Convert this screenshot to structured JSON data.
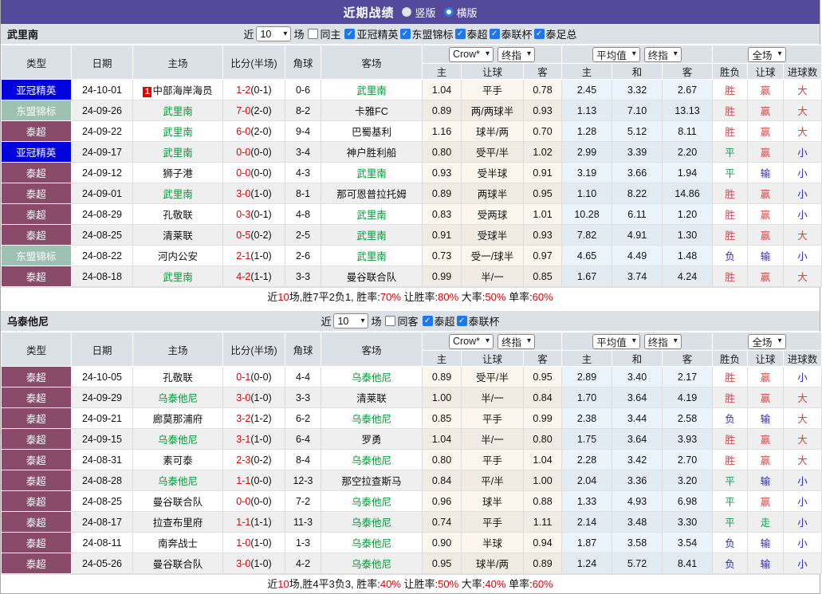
{
  "colors": {
    "bar": "#54499b",
    "headbg": "#dce1e8",
    "acl": "#0202dd",
    "asean": "#9dc1b2",
    "thai": "#8a4b6b",
    "green": "#009933",
    "red": "#e60000",
    "resred": "#d94545",
    "resblue": "#2a2ac8",
    "resgreen": "#13a04c",
    "cream1": "#fbf6ee",
    "cream2": "#f0ece4",
    "blue1": "#eaf4fa",
    "blue2": "#e1ebf1",
    "cbblue": "#1d78ee"
  },
  "titlebar": {
    "title": "近期战绩",
    "layout_options": [
      {
        "label": "竖版",
        "selected": false
      },
      {
        "label": "横版",
        "selected": true
      }
    ]
  },
  "sections": [
    {
      "team": "武里南",
      "controls": {
        "near": "近",
        "count": "10",
        "unit": "场",
        "venue_filter": {
          "label": "同主",
          "checked": false
        },
        "league_filters": [
          {
            "label": "亚冠精英",
            "checked": true
          },
          {
            "label": "东盟锦标",
            "checked": true
          },
          {
            "label": "泰超",
            "checked": true
          },
          {
            "label": "泰联杯",
            "checked": true
          },
          {
            "label": "泰足总",
            "checked": true
          }
        ]
      },
      "selects": {
        "bookmaker": "Crow*",
        "final1": "终指",
        "average": "平均值",
        "final2": "终指",
        "scope": "全场"
      },
      "cols": {
        "type": "类型",
        "date": "日期",
        "home": "主场",
        "score": "比分(半场)",
        "corner": "角球",
        "away": "客场",
        "h": "主",
        "handicap": "让球",
        "a": "客",
        "avg_h": "主",
        "avg_d": "和",
        "avg_a": "客",
        "result": "胜负",
        "hres": "让球",
        "goals": "进球数"
      },
      "rows": [
        {
          "lg": "亚冠精英",
          "lgc": "acl",
          "date": "24-10-01",
          "home": "中部海岸海员",
          "hred": true,
          "hteam": false,
          "score": "1-2",
          "half": "(0-1)",
          "cn": "0-6",
          "away": "武里南",
          "ateam": true,
          "o1": "1.04",
          "line": "平手",
          "o2": "0.78",
          "a1": "2.45",
          "a2": "3.32",
          "a3": "2.67",
          "r": [
            "胜",
            "r"
          ],
          "h": [
            "赢",
            "r"
          ],
          "g": [
            "大",
            "r"
          ]
        },
        {
          "lg": "东盟锦标",
          "lgc": "asean",
          "date": "24-09-26",
          "home": "武里南",
          "hred": false,
          "hteam": true,
          "score": "7-0",
          "half": "(2-0)",
          "cn": "8-2",
          "away": "卡雅FC",
          "ateam": false,
          "o1": "0.89",
          "line": "两/两球半",
          "o2": "0.93",
          "a1": "1.13",
          "a2": "7.10",
          "a3": "13.13",
          "r": [
            "胜",
            "r"
          ],
          "h": [
            "赢",
            "r"
          ],
          "g": [
            "大",
            "r"
          ]
        },
        {
          "lg": "泰超",
          "lgc": "thai",
          "date": "24-09-22",
          "home": "武里南",
          "hred": false,
          "hteam": true,
          "score": "6-0",
          "half": "(2-0)",
          "cn": "9-4",
          "away": "巴蜀基利",
          "ateam": false,
          "o1": "1.16",
          "line": "球半/两",
          "o2": "0.70",
          "a1": "1.28",
          "a2": "5.12",
          "a3": "8.11",
          "r": [
            "胜",
            "r"
          ],
          "h": [
            "赢",
            "r"
          ],
          "g": [
            "大",
            "r"
          ]
        },
        {
          "lg": "亚冠精英",
          "lgc": "acl",
          "date": "24-09-17",
          "home": "武里南",
          "hred": false,
          "hteam": true,
          "score": "0-0",
          "half": "(0-0)",
          "cn": "3-4",
          "away": "神户胜利船",
          "ateam": false,
          "o1": "0.80",
          "line": "受平/半",
          "o2": "1.02",
          "a1": "2.99",
          "a2": "3.39",
          "a3": "2.20",
          "r": [
            "平",
            "g"
          ],
          "h": [
            "赢",
            "r"
          ],
          "g": [
            "小",
            "b"
          ]
        },
        {
          "lg": "泰超",
          "lgc": "thai",
          "date": "24-09-12",
          "home": "狮子港",
          "hred": false,
          "hteam": false,
          "score": "0-0",
          "half": "(0-0)",
          "cn": "4-3",
          "away": "武里南",
          "ateam": true,
          "o1": "0.93",
          "line": "受半球",
          "o2": "0.91",
          "a1": "3.19",
          "a2": "3.66",
          "a3": "1.94",
          "r": [
            "平",
            "g"
          ],
          "h": [
            "输",
            "b"
          ],
          "g": [
            "小",
            "b"
          ]
        },
        {
          "lg": "泰超",
          "lgc": "thai",
          "date": "24-09-01",
          "home": "武里南",
          "hred": false,
          "hteam": true,
          "score": "3-0",
          "half": "(1-0)",
          "cn": "8-1",
          "away": "那可恩普拉托姆",
          "ateam": false,
          "o1": "0.89",
          "line": "两球半",
          "o2": "0.95",
          "a1": "1.10",
          "a2": "8.22",
          "a3": "14.86",
          "r": [
            "胜",
            "r"
          ],
          "h": [
            "赢",
            "r"
          ],
          "g": [
            "小",
            "b"
          ]
        },
        {
          "lg": "泰超",
          "lgc": "thai",
          "date": "24-08-29",
          "home": "孔敬联",
          "hred": false,
          "hteam": false,
          "score": "0-3",
          "half": "(0-1)",
          "cn": "4-8",
          "away": "武里南",
          "ateam": true,
          "o1": "0.83",
          "line": "受两球",
          "o2": "1.01",
          "a1": "10.28",
          "a2": "6.11",
          "a3": "1.20",
          "r": [
            "胜",
            "r"
          ],
          "h": [
            "赢",
            "r"
          ],
          "g": [
            "小",
            "b"
          ]
        },
        {
          "lg": "泰超",
          "lgc": "thai",
          "date": "24-08-25",
          "home": "清莱联",
          "hred": false,
          "hteam": false,
          "score": "0-5",
          "half": "(0-2)",
          "cn": "2-5",
          "away": "武里南",
          "ateam": true,
          "o1": "0.91",
          "line": "受球半",
          "o2": "0.93",
          "a1": "7.82",
          "a2": "4.91",
          "a3": "1.30",
          "r": [
            "胜",
            "r"
          ],
          "h": [
            "赢",
            "r"
          ],
          "g": [
            "大",
            "r"
          ]
        },
        {
          "lg": "东盟锦标",
          "lgc": "asean",
          "date": "24-08-22",
          "home": "河内公安",
          "hred": false,
          "hteam": false,
          "score": "2-1",
          "half": "(1-0)",
          "cn": "2-6",
          "away": "武里南",
          "ateam": true,
          "o1": "0.73",
          "line": "受一/球半",
          "o2": "0.97",
          "a1": "4.65",
          "a2": "4.49",
          "a3": "1.48",
          "r": [
            "负",
            "b"
          ],
          "h": [
            "输",
            "b"
          ],
          "g": [
            "小",
            "b"
          ]
        },
        {
          "lg": "泰超",
          "lgc": "thai",
          "date": "24-08-18",
          "home": "武里南",
          "hred": false,
          "hteam": true,
          "score": "4-2",
          "half": "(1-1)",
          "cn": "3-3",
          "away": "曼谷联合队",
          "ateam": false,
          "o1": "0.99",
          "line": "半/一",
          "o2": "0.85",
          "a1": "1.67",
          "a2": "3.74",
          "a3": "4.24",
          "r": [
            "胜",
            "r"
          ],
          "h": [
            "赢",
            "r"
          ],
          "g": [
            "大",
            "r"
          ]
        }
      ],
      "summary": [
        [
          "近",
          "k"
        ],
        [
          "10",
          "r"
        ],
        [
          "场,胜7平2负1, 胜率:",
          "k"
        ],
        [
          "70%",
          "r"
        ],
        [
          " 让胜率:",
          "k"
        ],
        [
          "80%",
          "r"
        ],
        [
          " 大率:",
          "k"
        ],
        [
          "50%",
          "r"
        ],
        [
          " 单率:",
          "k"
        ],
        [
          "60%",
          "r"
        ]
      ]
    },
    {
      "team": "乌泰他尼",
      "controls": {
        "near": "近",
        "count": "10",
        "unit": "场",
        "venue_filter": {
          "label": "同客",
          "checked": false
        },
        "league_filters": [
          {
            "label": "泰超",
            "checked": true
          },
          {
            "label": "泰联杯",
            "checked": true
          }
        ]
      },
      "selects": {
        "bookmaker": "Crow*",
        "final1": "终指",
        "average": "平均值",
        "final2": "终指",
        "scope": "全场"
      },
      "cols": {
        "type": "类型",
        "date": "日期",
        "home": "主场",
        "score": "比分(半场)",
        "corner": "角球",
        "away": "客场",
        "h": "主",
        "handicap": "让球",
        "a": "客",
        "avg_h": "主",
        "avg_d": "和",
        "avg_a": "客",
        "result": "胜负",
        "hres": "让球",
        "goals": "进球数"
      },
      "rows": [
        {
          "lg": "泰超",
          "lgc": "thai",
          "date": "24-10-05",
          "home": "孔敬联",
          "hred": false,
          "hteam": false,
          "score": "0-1",
          "half": "(0-0)",
          "cn": "4-4",
          "away": "乌泰他尼",
          "ateam": true,
          "o1": "0.89",
          "line": "受平/半",
          "o2": "0.95",
          "a1": "2.89",
          "a2": "3.40",
          "a3": "2.17",
          "r": [
            "胜",
            "r"
          ],
          "h": [
            "赢",
            "r"
          ],
          "g": [
            "小",
            "b"
          ]
        },
        {
          "lg": "泰超",
          "lgc": "thai",
          "date": "24-09-29",
          "home": "乌泰他尼",
          "hred": false,
          "hteam": true,
          "score": "3-0",
          "half": "(1-0)",
          "cn": "3-3",
          "away": "清莱联",
          "ateam": false,
          "o1": "1.00",
          "line": "半/一",
          "o2": "0.84",
          "a1": "1.70",
          "a2": "3.64",
          "a3": "4.19",
          "r": [
            "胜",
            "r"
          ],
          "h": [
            "赢",
            "r"
          ],
          "g": [
            "大",
            "r"
          ]
        },
        {
          "lg": "泰超",
          "lgc": "thai",
          "date": "24-09-21",
          "home": "廊莫那浦府",
          "hred": false,
          "hteam": false,
          "score": "3-2",
          "half": "(1-2)",
          "cn": "6-2",
          "away": "乌泰他尼",
          "ateam": true,
          "o1": "0.85",
          "line": "平手",
          "o2": "0.99",
          "a1": "2.38",
          "a2": "3.44",
          "a3": "2.58",
          "r": [
            "负",
            "b"
          ],
          "h": [
            "输",
            "b"
          ],
          "g": [
            "大",
            "r"
          ]
        },
        {
          "lg": "泰超",
          "lgc": "thai",
          "date": "24-09-15",
          "home": "乌泰他尼",
          "hred": false,
          "hteam": true,
          "score": "3-1",
          "half": "(1-0)",
          "cn": "6-4",
          "away": "罗勇",
          "ateam": false,
          "o1": "1.04",
          "line": "半/一",
          "o2": "0.80",
          "a1": "1.75",
          "a2": "3.64",
          "a3": "3.93",
          "r": [
            "胜",
            "r"
          ],
          "h": [
            "赢",
            "r"
          ],
          "g": [
            "大",
            "r"
          ]
        },
        {
          "lg": "泰超",
          "lgc": "thai",
          "date": "24-08-31",
          "home": "素可泰",
          "hred": false,
          "hteam": false,
          "score": "2-3",
          "half": "(0-2)",
          "cn": "8-4",
          "away": "乌泰他尼",
          "ateam": true,
          "o1": "0.80",
          "line": "平手",
          "o2": "1.04",
          "a1": "2.28",
          "a2": "3.42",
          "a3": "2.70",
          "r": [
            "胜",
            "r"
          ],
          "h": [
            "赢",
            "r"
          ],
          "g": [
            "大",
            "r"
          ]
        },
        {
          "lg": "泰超",
          "lgc": "thai",
          "date": "24-08-28",
          "home": "乌泰他尼",
          "hred": false,
          "hteam": true,
          "score": "1-1",
          "half": "(0-0)",
          "cn": "12-3",
          "away": "那空拉查斯马",
          "ateam": false,
          "o1": "0.84",
          "line": "平/半",
          "o2": "1.00",
          "a1": "2.04",
          "a2": "3.36",
          "a3": "3.20",
          "r": [
            "平",
            "g"
          ],
          "h": [
            "输",
            "b"
          ],
          "g": [
            "小",
            "b"
          ]
        },
        {
          "lg": "泰超",
          "lgc": "thai",
          "date": "24-08-25",
          "home": "曼谷联合队",
          "hred": false,
          "hteam": false,
          "score": "0-0",
          "half": "(0-0)",
          "cn": "7-2",
          "away": "乌泰他尼",
          "ateam": true,
          "o1": "0.96",
          "line": "球半",
          "o2": "0.88",
          "a1": "1.33",
          "a2": "4.93",
          "a3": "6.98",
          "r": [
            "平",
            "g"
          ],
          "h": [
            "赢",
            "r"
          ],
          "g": [
            "小",
            "b"
          ]
        },
        {
          "lg": "泰超",
          "lgc": "thai",
          "date": "24-08-17",
          "home": "拉查布里府",
          "hred": false,
          "hteam": false,
          "score": "1-1",
          "half": "(1-1)",
          "cn": "11-3",
          "away": "乌泰他尼",
          "ateam": true,
          "o1": "0.74",
          "line": "平手",
          "o2": "1.11",
          "a1": "2.14",
          "a2": "3.48",
          "a3": "3.30",
          "r": [
            "平",
            "g"
          ],
          "h": [
            "走",
            "g"
          ],
          "g": [
            "小",
            "b"
          ]
        },
        {
          "lg": "泰超",
          "lgc": "thai",
          "date": "24-08-11",
          "home": "南奔战士",
          "hred": false,
          "hteam": false,
          "score": "1-0",
          "half": "(1-0)",
          "cn": "1-3",
          "away": "乌泰他尼",
          "ateam": true,
          "o1": "0.90",
          "line": "半球",
          "o2": "0.94",
          "a1": "1.87",
          "a2": "3.58",
          "a3": "3.54",
          "r": [
            "负",
            "b"
          ],
          "h": [
            "输",
            "b"
          ],
          "g": [
            "小",
            "b"
          ]
        },
        {
          "lg": "泰超",
          "lgc": "thai",
          "date": "24-05-26",
          "home": "曼谷联合队",
          "hred": false,
          "hteam": false,
          "score": "3-0",
          "half": "(1-0)",
          "cn": "4-2",
          "away": "乌泰他尼",
          "ateam": true,
          "o1": "0.95",
          "line": "球半/两",
          "o2": "0.89",
          "a1": "1.24",
          "a2": "5.72",
          "a3": "8.41",
          "r": [
            "负",
            "b"
          ],
          "h": [
            "输",
            "b"
          ],
          "g": [
            "小",
            "b"
          ]
        }
      ],
      "summary": [
        [
          "近",
          "k"
        ],
        [
          "10",
          "r"
        ],
        [
          "场,胜4平3负3, 胜率:",
          "k"
        ],
        [
          "40%",
          "r"
        ],
        [
          " 让胜率:",
          "k"
        ],
        [
          "50%",
          "r"
        ],
        [
          " 大率:",
          "k"
        ],
        [
          "40%",
          "r"
        ],
        [
          " 单率:",
          "k"
        ],
        [
          "60%",
          "r"
        ]
      ]
    }
  ]
}
